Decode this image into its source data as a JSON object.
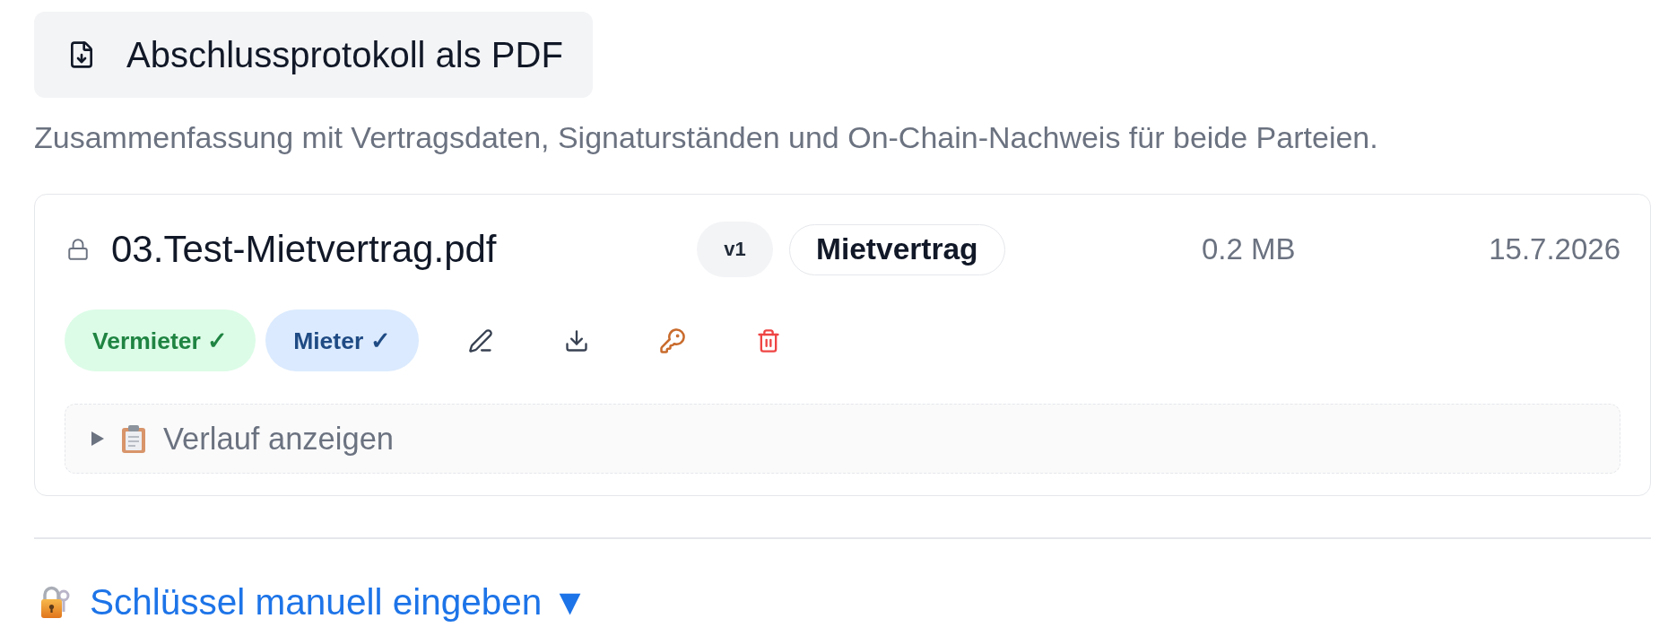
{
  "export_button": {
    "label": "Abschlussprotokoll als PDF"
  },
  "export_description": "Zusammenfassung mit Vertragsdaten, Signaturständen und On-Chain-Nachweis für beide Parteien.",
  "document": {
    "name": "03.Test-Mietvertrag.pdf",
    "locked": true,
    "version": "v1",
    "category": "Mietvertrag",
    "size": "0.2 MB",
    "date": "15.7.2026",
    "signatures": [
      {
        "label": "Vermieter ✓",
        "color": "#dcfce7"
      },
      {
        "label": "Mieter ✓",
        "color": "#dbeafe"
      }
    ],
    "history": {
      "label": "Verlauf anzeigen",
      "expanded": false
    }
  },
  "manual_key": {
    "label": "Schlüssel manuell eingeben ▼"
  }
}
